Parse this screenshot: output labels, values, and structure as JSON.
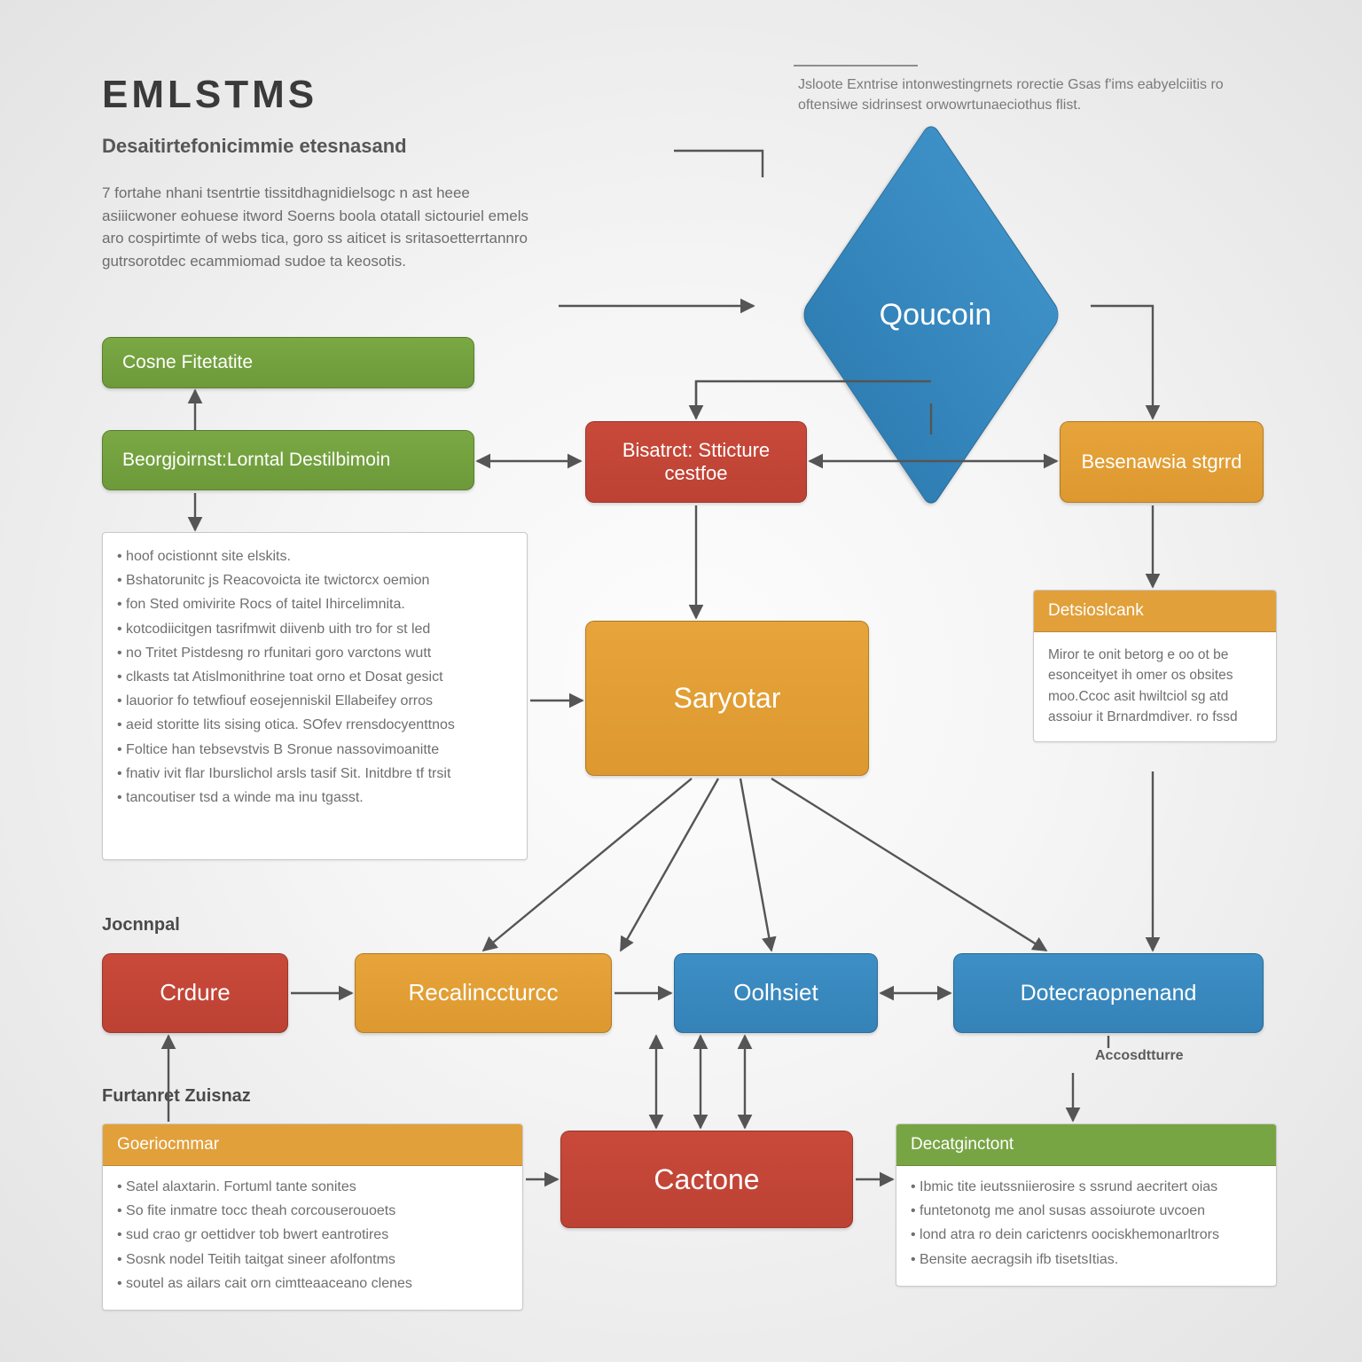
{
  "title": "EMLSTMS",
  "subtitle": "Desaitirtefonicimmie etesnasand",
  "intro_para": "7 fortahe nhani tsentrtie tissitdhagnidielsogc n ast heee asiiicwoner eohuese itword Soerns boola otatall sictouriel emels aro cospirtimte of webs tica, goro ss aiticet is sritasoetterrtannro gutrsorotdec ecammiomad sudoe ta keosotis.",
  "corner_note": "Jsloote Exntrise intonwestingrnets rorectie Gsas f'ims eabyelciitis ro oftensiwe sidrinsest orwowrtunaeciothus flist.",
  "diamond": "Qoucoin",
  "blocks": {
    "green1": "Cosne Fitetatite",
    "green2": "Beorgjoirnst:Lorntal Destilbimoin",
    "red_structure": "Bisatrct: Stticture cestfoe",
    "orange_right1": "Besenawsia stgrrd",
    "saryotar": "Saryotar",
    "crdure": "Crdure",
    "recal": "Recalinccturcc",
    "oolhsiet": "Oolhsiet",
    "dotec": "Dotecraopnenand",
    "cactone": "Cactone"
  },
  "section_labels": {
    "jocnnpal": "Jocnnpal",
    "furtanret": "Furtanret Zuisnaz",
    "accost": "Accosdtturre"
  },
  "panels": {
    "dets": {
      "header": "Detsioslcank",
      "body": "Miror te onit betorg e oo ot be esonceityet ih omer os obsites moo.Ccoc asit hwiltciol sg atd assoiur it Brnardmdiver. ro fssd"
    },
    "left": {
      "header": "Goeriocmmar",
      "bullets": [
        "Satel alaxtarin. Fortuml tante sonites",
        "So fite inmatre tocc theah corcouserouoets",
        "sud crao gr oettidver tob bwert eantrotires",
        "Sosnk nodel Teitih taitgat sineer afolfontms",
        "soutel as ailars cait orn cimtteaaceano clenes"
      ]
    },
    "right": {
      "header": "Decatginctont",
      "bullets": [
        "Ibmic tite ieutssniierosire s ssrund aecritert oias",
        "funtetonotg me anol susas assoiurote uvcoen",
        "lond atra ro dein carictenrs oociskhemonarltrors",
        "Bensite aecragsih ifb tisetsItias."
      ]
    }
  },
  "mid_bullets": [
    "hoof ocistionnt site elskits.",
    "Bshatorunitc js Reacovoicta ite twictorcx oemion",
    "fon Sted omivirite Rocs of taitel Ihircelimnita.",
    "kotcodiicitgen tasrifmwit diivenb uith tro for st led",
    "no Tritet Pistdesng ro rfunitari goro varctons wutt",
    "clkasts tat Atislmonithrine toat orno et Dosat gesict",
    "lauorior fo tetwfiouf eosejenniskil  Ellabeifey orros",
    "aeid storitte lits sising otica.  SOfev rrensdocyenttnos",
    "Foltice han tebsevstvis B Sronue nassovimoanitte",
    "fnativ ivit flar Iburslichol arsls tasif Sit.  Initdbre tf trsit",
    "tancoutiser tsd a winde ma inu tgasst."
  ]
}
